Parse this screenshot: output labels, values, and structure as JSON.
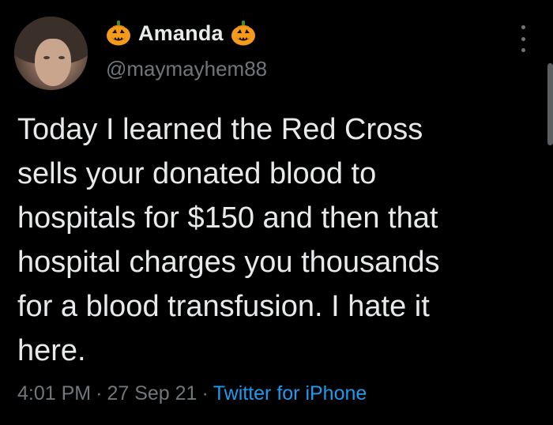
{
  "user": {
    "display_name": "Amanda",
    "handle": "@maymayhem88",
    "name_emoji": "jack-o-lantern-icon"
  },
  "tweet": {
    "lines": [
      "Today I learned the Red Cross",
      "sells your donated blood to",
      "hospitals for $150 and then that",
      "hospital charges you thousands",
      "for a blood transfusion. I hate it",
      "here."
    ]
  },
  "meta": {
    "time": "4:01 PM",
    "separator": "·",
    "date": "27 Sep 21",
    "source": "Twitter for iPhone"
  },
  "colors": {
    "background": "#000000",
    "text": "#e7e9ea",
    "secondary": "#71767b",
    "link": "#1d9bf0",
    "pumpkin": "#f59b1c"
  }
}
